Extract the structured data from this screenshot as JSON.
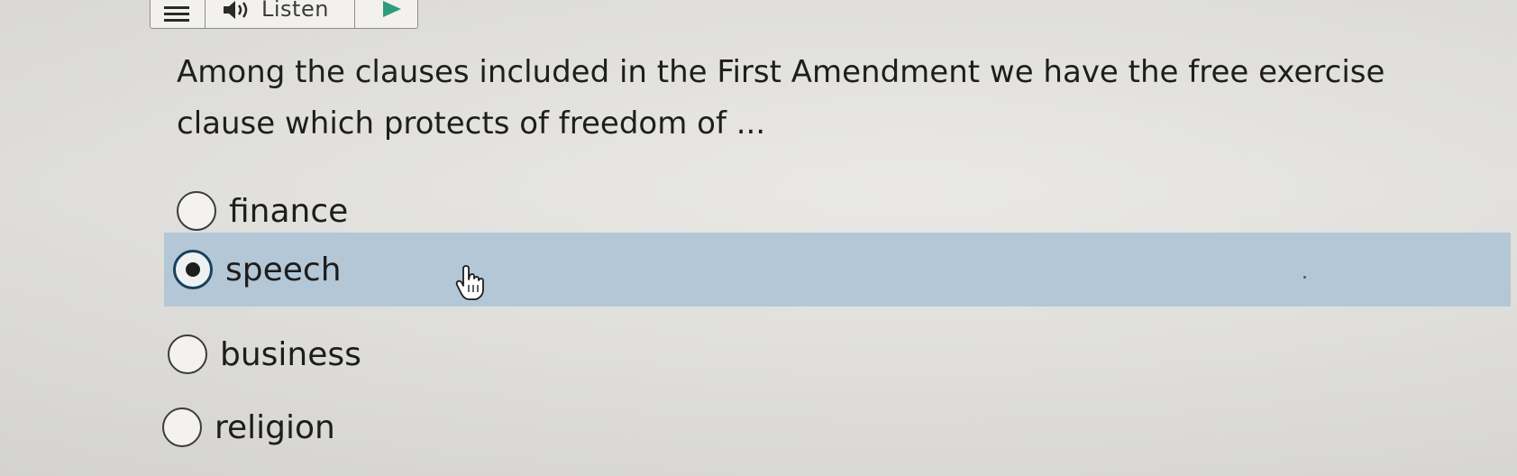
{
  "toolbar": {
    "menu_icon": "hamburger-menu-icon",
    "speaker_icon": "speaker-icon",
    "listen_label": "Listen",
    "play_icon": "play-icon"
  },
  "question": {
    "text": "Among the clauses included in the First Amendment we have the free exercise clause which protects of freedom of ..."
  },
  "options": [
    {
      "label": "finance",
      "selected": false
    },
    {
      "label": "speech",
      "selected": true
    },
    {
      "label": "business",
      "selected": false
    },
    {
      "label": "religion",
      "selected": false
    }
  ],
  "colors": {
    "selected_highlight": "#b4c7d6",
    "selected_radio_border": "#16415e",
    "play_icon": "#2f9a7c"
  },
  "cursor": "hand-pointer-icon"
}
